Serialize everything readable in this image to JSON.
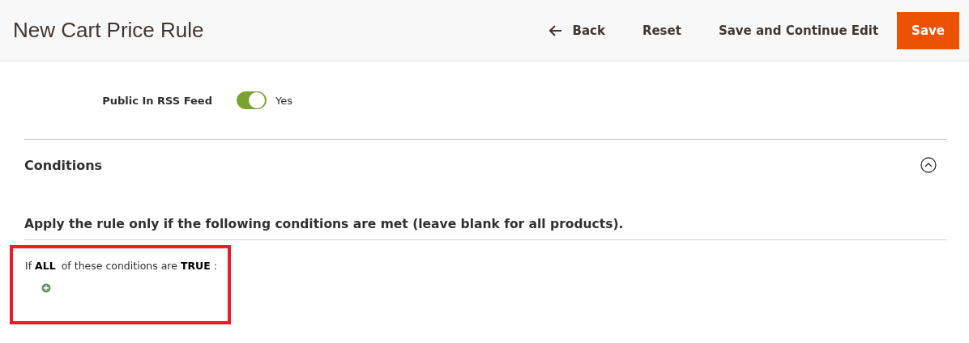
{
  "page_title": "New Cart Price Rule",
  "actions": [
    {
      "kind": "back",
      "label": "Back"
    },
    {
      "kind": "plain",
      "label": "Reset"
    },
    {
      "kind": "plain",
      "label": "Save and Continue Edit"
    },
    {
      "kind": "primary",
      "label": "Save"
    }
  ],
  "rss_field": {
    "label": "Public In RSS Feed",
    "on": true,
    "value": "Yes"
  },
  "conditions_section": {
    "title": "Conditions",
    "expanded": true,
    "intro": "Apply the rule only if the following conditions are met (leave blank for all products).",
    "rule": {
      "prefix": "If",
      "aggregator": "ALL",
      "middle": "of these conditions are",
      "value": "TRUE",
      "suffix": ":"
    },
    "highlighted": true
  }
}
